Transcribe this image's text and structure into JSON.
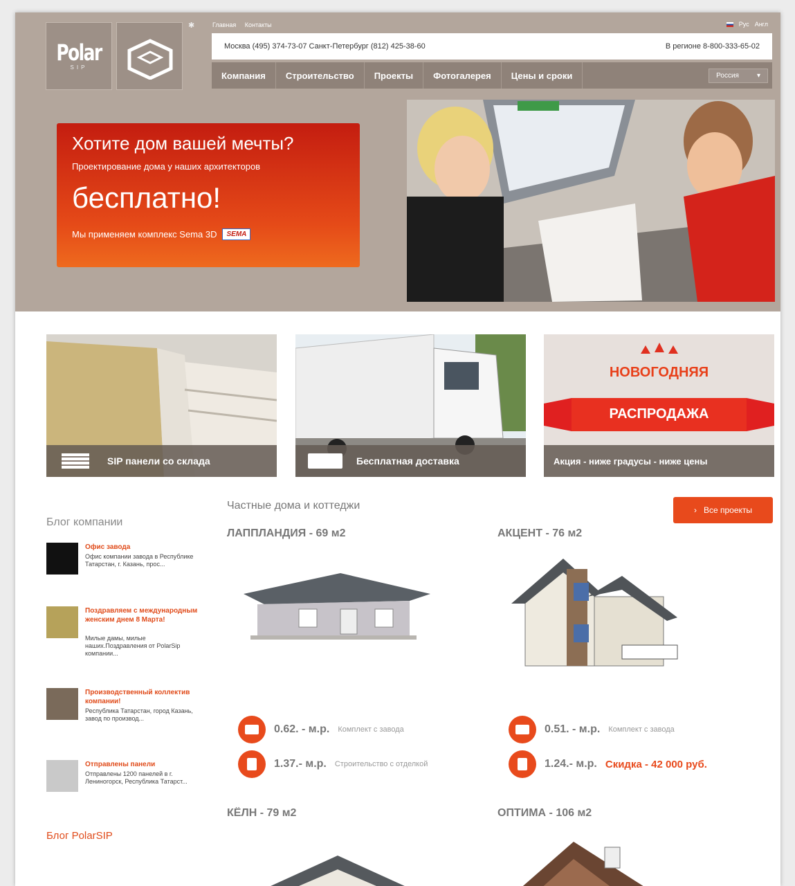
{
  "header": {
    "logo_text": "Polar",
    "logo_sub": "SIP",
    "top_links": [
      "Главная",
      "Контакты"
    ],
    "lang": [
      "Рус",
      "Англ"
    ],
    "contacts_left": "Москва (495) 374-73-07 Санкт-Петербург (812) 425-38-60",
    "contacts_right": "В регионе 8-800-333-65-02",
    "nav": [
      "Компания",
      "Строительство",
      "Проекты",
      "Фотогалерея",
      "Цены и сроки"
    ],
    "region_select": "Россия"
  },
  "promo": {
    "title": "Хотите дом вашей мечты?",
    "subtitle": "Проектирование дома у наших архитекторов",
    "big": "бесплатно!",
    "footer": "Мы применяем комплекс Sema 3D",
    "badge": "SEMA"
  },
  "tiles": [
    {
      "caption": "SIP панели со склада"
    },
    {
      "caption": "Бесплатная доставка"
    },
    {
      "caption": "Акция - ниже градусы - ниже цены",
      "heading": "НОВОГОДНЯЯ",
      "ribbon": "РАСПРОДАЖА"
    }
  ],
  "blog": {
    "title": "Блог компании",
    "posts": [
      {
        "title": "Офис завода",
        "text": "Офис компании завода в Республике Татарстан, г. Казань, прос..."
      },
      {
        "title": "Поздравляем с международным женским днем 8 Марта!",
        "text": "Милые дамы, милые наших.Поздравления от PolarSip компании..."
      },
      {
        "title": "Производственный коллектив компании!",
        "text": "Республика Татарстан, город Казань, завод по производ..."
      },
      {
        "title": "Отправлены панели",
        "text": "Отправлены 1200 панелей в г. Лениногорск, Республика Татарст..."
      }
    ],
    "second_title": "Блог PolarSIP"
  },
  "projects": {
    "title": "Частные дома и коттеджи",
    "all_button": "Все проекты",
    "items": [
      {
        "name": "ЛАППЛАНДИЯ - 69 м2",
        "price1": "0.62. - м.р.",
        "desc1": "Комплект с завода",
        "price2": "1.37.- м.р.",
        "desc2": "Строительство с отделкой"
      },
      {
        "name": "АКЦЕНТ - 76 м2",
        "price1": "0.51. - м.р.",
        "desc1": "Комплект с завода",
        "price2": "1.24.- м.р.",
        "desc2": "Скидка - 42 000 руб."
      },
      {
        "name": "КЁЛН - 79 м2"
      },
      {
        "name": "ОПТИМА - 106 м2"
      }
    ]
  }
}
